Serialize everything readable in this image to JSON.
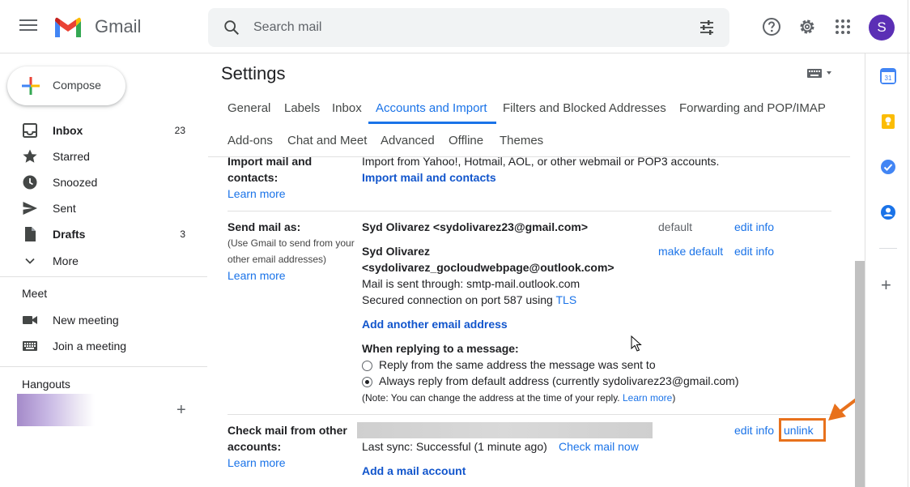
{
  "header": {
    "brand": "Gmail",
    "search_placeholder": "Search mail",
    "avatar_letter": "S"
  },
  "compose": {
    "label": "Compose"
  },
  "nav": {
    "items": [
      {
        "label": "Inbox",
        "count": "23",
        "bold": true,
        "icon": "inbox-icon"
      },
      {
        "label": "Starred",
        "count": "",
        "bold": false,
        "icon": "star-icon"
      },
      {
        "label": "Snoozed",
        "count": "",
        "bold": false,
        "icon": "clock-icon"
      },
      {
        "label": "Sent",
        "count": "",
        "bold": false,
        "icon": "send-icon"
      },
      {
        "label": "Drafts",
        "count": "3",
        "bold": true,
        "icon": "draft-icon"
      },
      {
        "label": "More",
        "count": "",
        "bold": false,
        "icon": "chevron-down-icon"
      }
    ],
    "meet_title": "Meet",
    "meet_items": [
      {
        "label": "New meeting",
        "icon": "video-icon"
      },
      {
        "label": "Join a meeting",
        "icon": "keyboard-icon"
      }
    ],
    "hangouts_title": "Hangouts"
  },
  "settings": {
    "title": "Settings",
    "tabs_row1": [
      "General",
      "Labels",
      "Inbox",
      "Accounts and Import",
      "Filters and Blocked Addresses",
      "Forwarding and POP/IMAP"
    ],
    "tabs_row2": [
      "Add-ons",
      "Chat and Meet",
      "Advanced",
      "Offline",
      "Themes"
    ],
    "active_tab": "Accounts and Import",
    "import": {
      "label_line1": "Import mail and",
      "label_line2": "contacts:",
      "learn_more": "Learn more",
      "desc": "Import from Yahoo!, Hotmail, AOL, or other webmail or POP3 accounts.",
      "action": "Import mail and contacts"
    },
    "send_as": {
      "label": "Send mail as:",
      "sub_line1": "(Use Gmail to send from your",
      "sub_line2": "other email addresses)",
      "learn_more": "Learn more",
      "primary": "Syd Olivarez <sydolivarez23@gmail.com>",
      "primary_status": "default",
      "primary_edit": "edit info",
      "secondary_name": "Syd Olivarez",
      "secondary_email": "<sydolivarez_gocloudwebpage@outlook.com>",
      "secondary_make_default": "make default",
      "secondary_edit": "edit info",
      "sent_through": "Mail is sent through: smtp-mail.outlook.com",
      "secured": "Secured connection on port 587 using",
      "tls": "TLS",
      "add_another": "Add another email address",
      "reply_title": "When replying to a message:",
      "reply_opt1": "Reply from the same address the message was sent to",
      "reply_opt2": "Always reply from default address (currently sydolivarez23@gmail.com)",
      "note": "(Note: You can change the address at the time of your reply.",
      "note_link": "Learn more",
      "note_end": ")"
    },
    "check_mail": {
      "label_line1": "Check mail from other",
      "label_line2": "accounts:",
      "learn_more": "Learn more",
      "last_sync": "Last sync: Successful (1 minute ago)",
      "check_now": "Check mail now",
      "edit": "edit info",
      "unlink": "unlink",
      "add_account": "Add a mail account"
    }
  },
  "colors": {
    "accent": "#1a73e8",
    "highlight": "#e8711c",
    "avatar": "#5b2fb5"
  }
}
